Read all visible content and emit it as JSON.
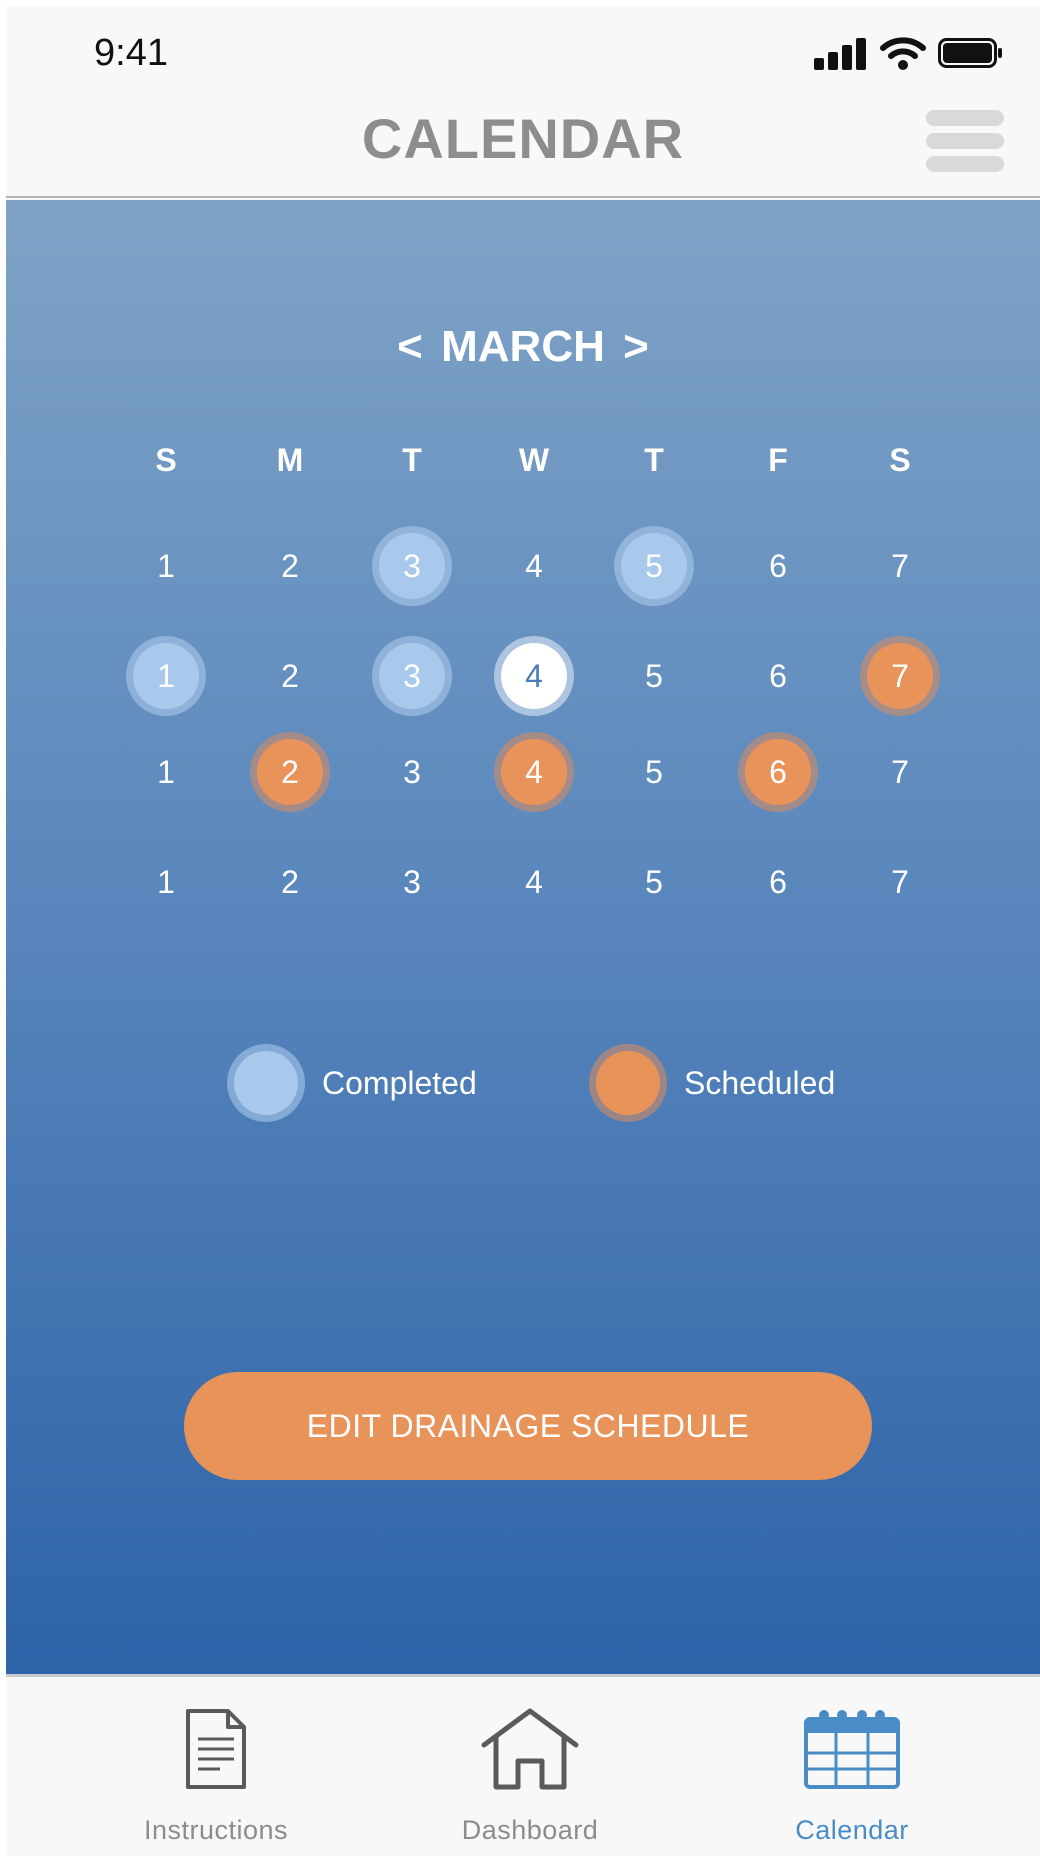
{
  "status_bar": {
    "time": "9:41"
  },
  "header": {
    "title": "CALENDAR"
  },
  "calendar": {
    "prev_arrow": "<",
    "month": "MARCH",
    "next_arrow": ">",
    "weekdays": [
      "S",
      "M",
      "T",
      "W",
      "T",
      "F",
      "S"
    ],
    "weeks": [
      [
        {
          "d": "1"
        },
        {
          "d": "2"
        },
        {
          "d": "3",
          "s": "completed"
        },
        {
          "d": "4"
        },
        {
          "d": "5",
          "s": "completed"
        },
        {
          "d": "6"
        },
        {
          "d": "7"
        }
      ],
      [
        {
          "d": "1",
          "s": "completed"
        },
        {
          "d": "2"
        },
        {
          "d": "3",
          "s": "completed"
        },
        {
          "d": "4",
          "s": "today"
        },
        {
          "d": "5"
        },
        {
          "d": "6"
        },
        {
          "d": "7",
          "s": "scheduled"
        }
      ],
      [
        {
          "d": "1"
        },
        {
          "d": "2",
          "s": "scheduled"
        },
        {
          "d": "3"
        },
        {
          "d": "4",
          "s": "scheduled"
        },
        {
          "d": "5"
        },
        {
          "d": "6",
          "s": "scheduled"
        },
        {
          "d": "7"
        }
      ],
      [
        {
          "d": "1"
        },
        {
          "d": "2"
        },
        {
          "d": "3"
        },
        {
          "d": "4"
        },
        {
          "d": "5"
        },
        {
          "d": "6"
        },
        {
          "d": "7"
        }
      ]
    ]
  },
  "legend": {
    "completed": "Completed",
    "scheduled": "Scheduled"
  },
  "colors": {
    "completed": "#a8c9ec",
    "scheduled": "#e8935a",
    "accent": "#4a8dc6"
  },
  "actions": {
    "edit_schedule": "EDIT DRAINAGE SCHEDULE"
  },
  "tabs": [
    {
      "label": "Instructions",
      "icon": "document-icon",
      "active": false
    },
    {
      "label": "Dashboard",
      "icon": "home-icon",
      "active": false
    },
    {
      "label": "Calendar",
      "icon": "calendar-icon",
      "active": true
    }
  ]
}
